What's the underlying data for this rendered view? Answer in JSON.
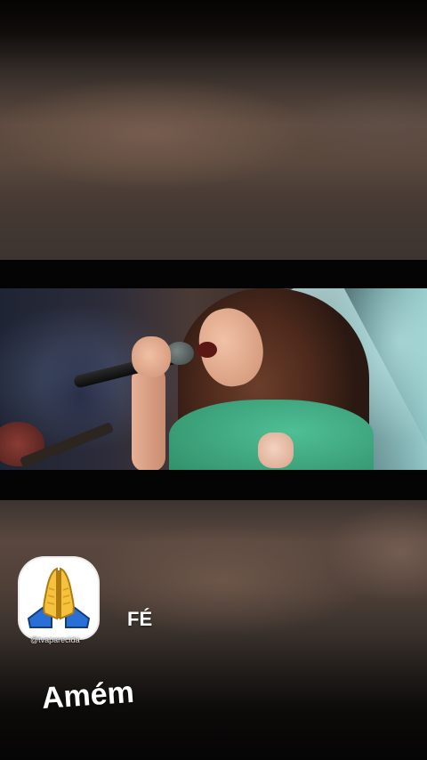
{
  "story": {
    "sticker_icon": "praying-hands-icon",
    "watermark": "@tvaparecida",
    "caption_fe": "FÉ",
    "caption_amem": "Amém"
  },
  "colors": {
    "letterbox": "#040404",
    "dress": "#4fbf95",
    "sticker_blue": "#2a6fd6",
    "sticker_yellow": "#f4c23c"
  }
}
